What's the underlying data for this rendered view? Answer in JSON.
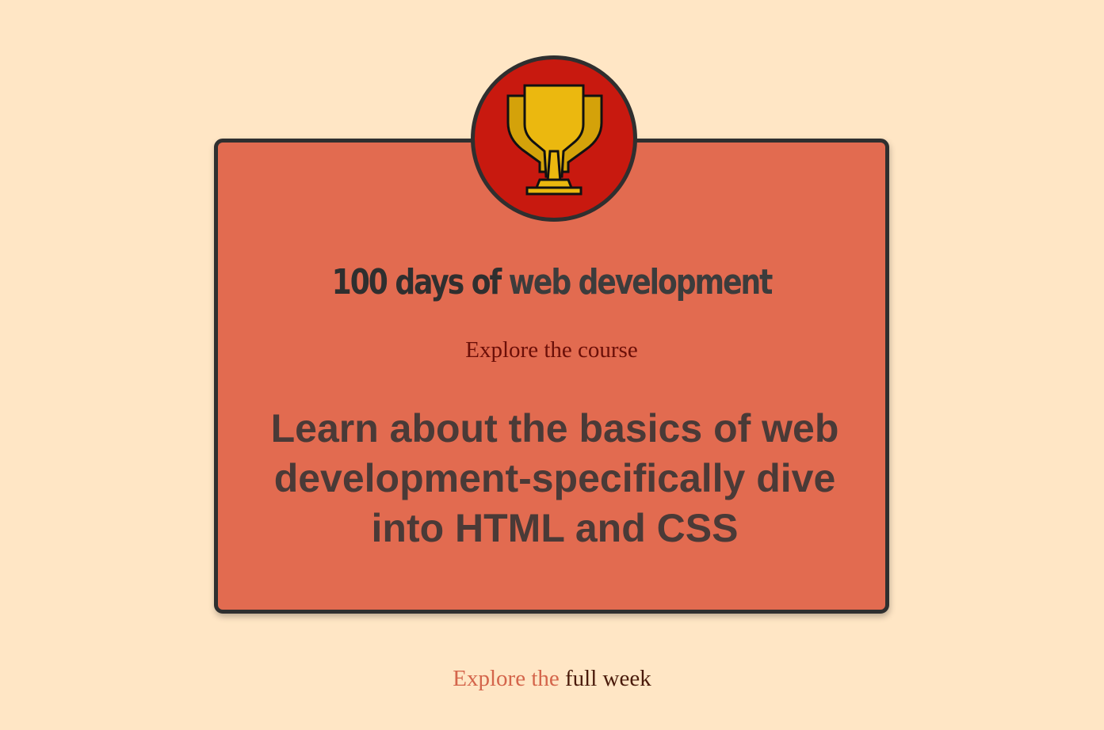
{
  "badge": {
    "icon": "trophy-icon",
    "colors": {
      "background": "#c8190f",
      "trophy": "#ebb80f"
    }
  },
  "card": {
    "title_main": "100 days of",
    "title_accent": "web development",
    "subtitle": "Explore the course",
    "description": "Learn about the basics of web development-specifically dive into HTML and CSS"
  },
  "footer": {
    "prefix": "Explore the",
    "link_label": "full week"
  },
  "colors": {
    "page_background": "#ffe6c5",
    "card_background": "#e26b50",
    "border": "#2f2f2f"
  }
}
